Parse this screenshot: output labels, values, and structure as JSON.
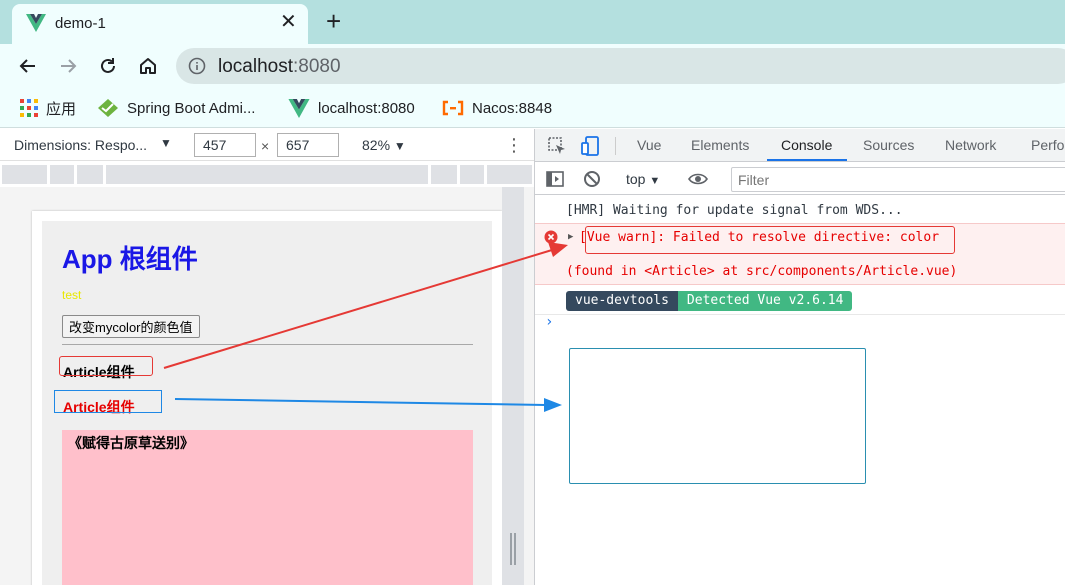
{
  "browser": {
    "tab_title": "demo-1",
    "url_host": "localhost",
    "url_port": ":8080",
    "bookmarks": [
      {
        "label": "应用",
        "icon": "apps-grid-icon"
      },
      {
        "label": "Spring Boot Admi...",
        "icon": "spring-boot-admin-icon"
      },
      {
        "label": "localhost:8080",
        "icon": "vue-logo-icon"
      },
      {
        "label": "Nacos:8848",
        "icon": "nacos-icon"
      }
    ]
  },
  "device_toolbar": {
    "dimensions_label": "Dimensions: Respo...",
    "width": "457",
    "times": "×",
    "height": "657",
    "zoom": "82%"
  },
  "page": {
    "title": "App 根组件",
    "test_text": "test",
    "button_label": "改变mycolor的颜色值",
    "article1": "Article组件",
    "article2": "Article组件",
    "poem_title": "《赋得古原草送别》"
  },
  "devtools": {
    "tabs": [
      "Vue",
      "Elements",
      "Console",
      "Sources",
      "Network",
      "Perfo"
    ],
    "active_tab": "Console",
    "context": "top",
    "filter_placeholder": "Filter",
    "console": {
      "log1": "[HMR] Waiting for update signal from WDS...",
      "error_msg": "[Vue warn]: Failed to resolve directive: color",
      "error_found": "(found in <Article> at src/components/Article.vue)",
      "devtools_badge_a": "vue-devtools",
      "devtools_badge_b": "Detected Vue v2.6.14",
      "prompt": "›"
    }
  },
  "colors": {
    "app_title": "#1a17e6",
    "error_text": "#e60000",
    "vue_green": "#41b883",
    "vue_dark": "#35495e",
    "pink_box": "#ffc0cb"
  }
}
